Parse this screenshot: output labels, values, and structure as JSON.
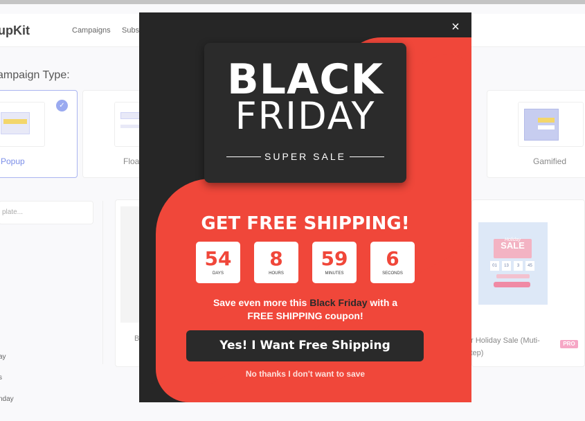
{
  "app": {
    "logo": "upKit",
    "nav": [
      "Campaigns",
      "Subs"
    ]
  },
  "campaign_type": {
    "title": "ampaign Type:",
    "cards": [
      {
        "label": "Popup",
        "selected": true
      },
      {
        "label": "Floa"
      },
      {
        "label": "Gamified"
      }
    ]
  },
  "sidebar": {
    "search_placeholder": "plate...",
    "items": [
      "ay",
      "s",
      "nday"
    ]
  },
  "templates": {
    "left_label": "B",
    "right_label": "er Holiday Sale (Muti-step)",
    "right_badge": "PRO",
    "thumb": {
      "hol": "Holiday",
      "sale": "SALE",
      "counts": [
        "01",
        "13",
        "3",
        "45"
      ]
    }
  },
  "modal": {
    "close": "×",
    "bf_line1": "BLACK",
    "bf_line2": "FRIDAY",
    "bf_line3": "SUPER SALE",
    "headline": "GET FREE SHIPPING!",
    "countdown": [
      {
        "value": "54",
        "unit": "DAYS"
      },
      {
        "value": "8",
        "unit": "HOURS"
      },
      {
        "value": "59",
        "unit": "MINUTES"
      },
      {
        "value": "6",
        "unit": "SECONDS"
      }
    ],
    "save_pre": "Save even more this ",
    "save_hl": "Black Friday",
    "save_post": " with a",
    "save_line2": "FREE SHIPPING coupon!",
    "cta": "Yes! I Want Free Shipping",
    "decline": "No thanks I don't want to save"
  },
  "colors": {
    "accent": "#f0473a",
    "dark": "#262626"
  }
}
